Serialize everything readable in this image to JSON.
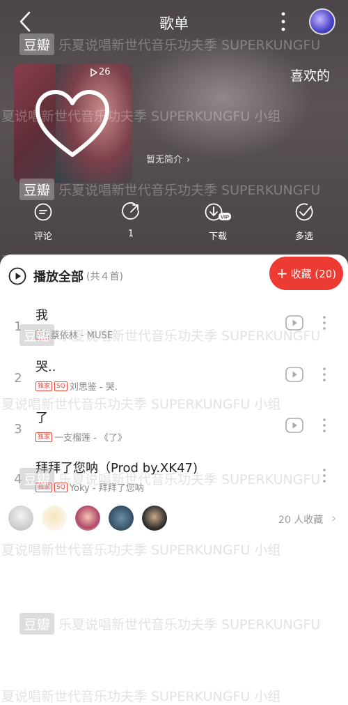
{
  "header": {
    "title": "歌单",
    "playlist_name": "喜欢的",
    "play_count": "26",
    "intro": "暂无简介"
  },
  "actions": [
    {
      "label": "评论",
      "icon": "comment-icon"
    },
    {
      "label": "1",
      "icon": "share-icon"
    },
    {
      "label": "下载",
      "icon": "download-vip-icon",
      "badge": "VIP"
    },
    {
      "label": "多选",
      "icon": "multiselect-icon"
    }
  ],
  "list": {
    "play_all": "播放全部",
    "count": "(共４首)",
    "fav_button": "收藏 (20)",
    "songs": [
      {
        "index": "1",
        "title": "我",
        "tags": [
          "SQ"
        ],
        "meta": "蔡依林 - MUSE"
      },
      {
        "index": "2",
        "title": "哭..",
        "tags": [
          "独家",
          "SQ"
        ],
        "meta": "刘思鉴 - 哭."
      },
      {
        "index": "3",
        "title": "了",
        "tags": [
          "独家"
        ],
        "meta": "一支榴莲 - 《了》"
      },
      {
        "index": "4",
        "title": "拜拜了您呐（Prod by.XK47)",
        "tags": [
          "独家",
          "SQ"
        ],
        "meta": "Yoky - 拜拜了您呐"
      }
    ],
    "collectors_text": "20 人收藏"
  },
  "watermark": {
    "brand": "豆瓣",
    "text_a": "乐夏说唱新世代音乐功夫季 SUPERKUNGFU",
    "text_b": "夏说唱新世代音乐功夫季 SUPERKUNGFU 小组"
  },
  "colors": {
    "accent": "#ec3b33",
    "tag": "#e8453c"
  }
}
